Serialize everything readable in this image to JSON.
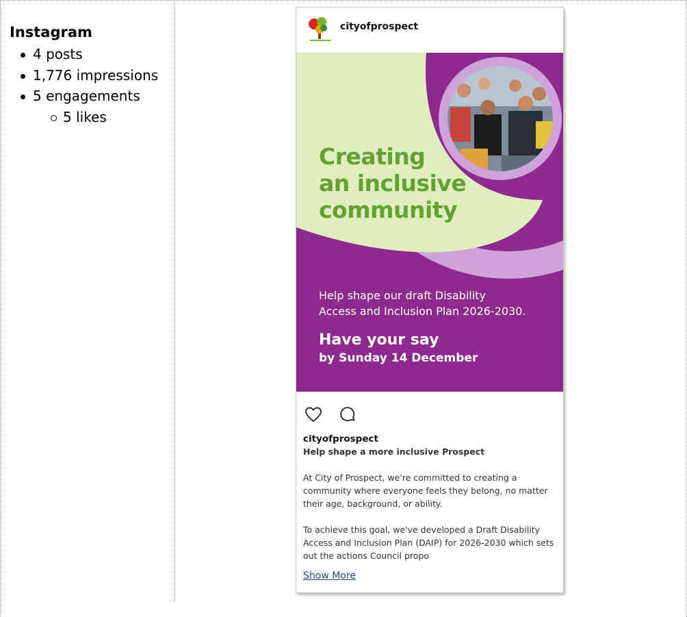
{
  "stats": {
    "title": "Instagram",
    "posts": "4 posts",
    "impressions": "1,776 impressions",
    "engagements": "5 engagements",
    "likes": "5 likes"
  },
  "post": {
    "handle": "cityofprospect",
    "image": {
      "headline": [
        "Creating",
        "an inclusive",
        "community"
      ],
      "subtext": [
        "Help shape our draft Disability",
        "Access and Inclusion Plan 2026-2030."
      ],
      "cta": "Have your say",
      "deadline": "by Sunday 14 December",
      "colors": {
        "background": "#8e2a8e",
        "light_green": "#e0eebf",
        "lilac": "#cda3d9",
        "headline_green": "#63a131"
      }
    },
    "actions": {
      "like_icon": "heart-icon",
      "comment_icon": "comment-icon"
    },
    "caption": {
      "user": "cityofprospect",
      "title": "Help shape a more inclusive Prospect",
      "paragraph1": "At City of Prospect, we're committed to creating a community where everyone feels they belong, no matter their age, background, or ability.",
      "paragraph2": "To achieve this goal, we've developed a Draft Disability Access and Inclusion Plan (DAIP) for 2026-2030 which sets out the actions Council propo",
      "show_more": "Show More"
    }
  }
}
